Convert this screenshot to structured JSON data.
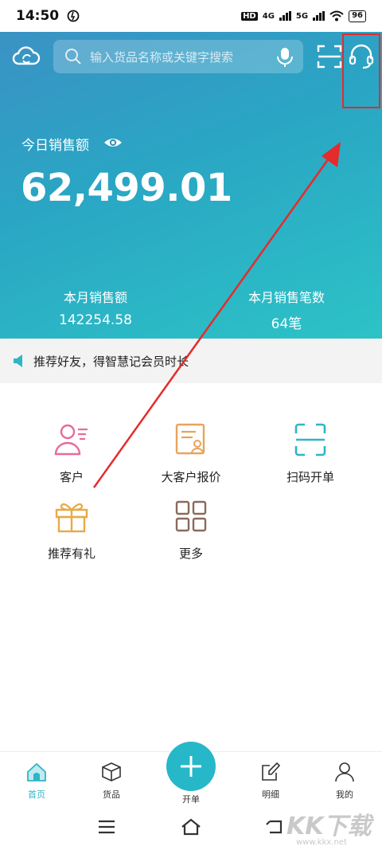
{
  "status": {
    "time": "14:50",
    "network_a": "HD",
    "network_b": "4G",
    "network_c": "5G",
    "battery": "96"
  },
  "header": {
    "search_placeholder": "输入货品名称或关键字搜索"
  },
  "sales": {
    "today_label": "今日销售额",
    "today_amount": "62,499.01",
    "month_sales_label": "本月销售额",
    "month_sales_value": "142254.58",
    "month_count_label": "本月销售笔数",
    "month_count_value": "64笔"
  },
  "notice": {
    "text": "推荐好友，得智慧记会员时长"
  },
  "grid": {
    "customer": "客户",
    "big_quote": "大客户报价",
    "scan_order": "扫码开单",
    "referral": "推荐有礼",
    "more": "更多"
  },
  "tabs": {
    "home": "首页",
    "goods": "货品",
    "new_order": "开单",
    "details": "明细",
    "mine": "我的"
  },
  "colors": {
    "accent": "#26b8c9",
    "annotation": "#e52b2b"
  },
  "watermark": {
    "brand": "KK下载",
    "url": "www.kkx.net"
  }
}
